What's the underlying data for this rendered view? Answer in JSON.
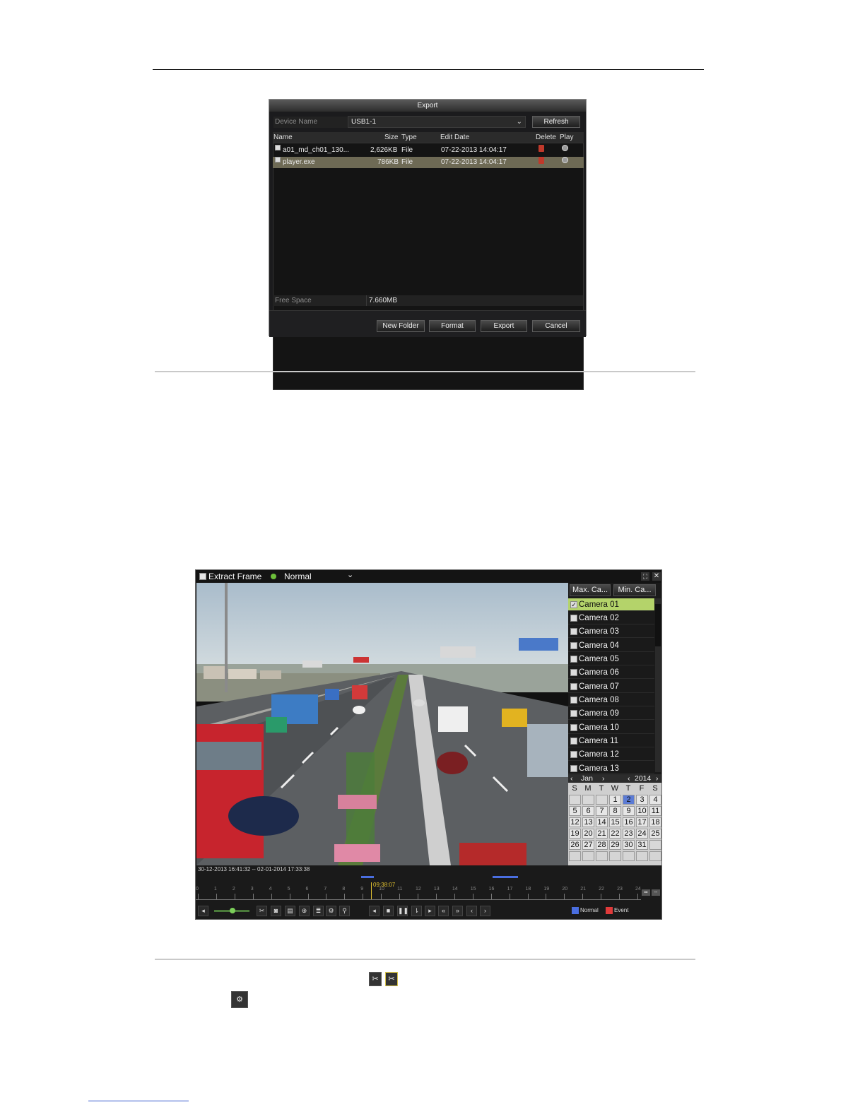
{
  "export_dialog": {
    "title": "Export",
    "device_name_label": "Device Name",
    "device_name_value": "USB1-1",
    "refresh_label": "Refresh",
    "columns": {
      "name": "Name",
      "size": "Size",
      "type": "Type",
      "edit_date": "Edit Date",
      "delete": "Delete",
      "play": "Play"
    },
    "files": [
      {
        "name": "a01_md_ch01_130...",
        "size": "2,626KB",
        "type": "File",
        "edit_date": "07-22-2013 14:04:17"
      },
      {
        "name": "player.exe",
        "size": "786KB",
        "type": "File",
        "edit_date": "07-22-2013 14:04:17"
      }
    ],
    "free_space_label": "Free Space",
    "free_space_value": "7.660MB",
    "buttons": {
      "new_folder": "New Folder",
      "format": "Format",
      "export": "Export",
      "cancel": "Cancel"
    }
  },
  "playback": {
    "extract_frame_label": "Extract Frame",
    "mode_value": "Normal",
    "tabs": {
      "max": "Max. Ca...",
      "min": "Min. Ca..."
    },
    "cameras": [
      "Camera 01",
      "Camera 02",
      "Camera 03",
      "Camera 04",
      "Camera 05",
      "Camera 06",
      "Camera 07",
      "Camera 08",
      "Camera 09",
      "Camera 10",
      "Camera 11",
      "Camera 12",
      "Camera 13"
    ],
    "calendar": {
      "month": "Jan",
      "year": "2014",
      "weekdays": [
        "S",
        "M",
        "T",
        "W",
        "T",
        "F",
        "S"
      ],
      "weeks": [
        [
          "",
          "",
          "",
          "1",
          "2",
          "3",
          "4"
        ],
        [
          "5",
          "6",
          "7",
          "8",
          "9",
          "10",
          "11"
        ],
        [
          "12",
          "13",
          "14",
          "15",
          "16",
          "17",
          "18"
        ],
        [
          "19",
          "20",
          "21",
          "22",
          "23",
          "24",
          "25"
        ],
        [
          "26",
          "27",
          "28",
          "29",
          "30",
          "31",
          ""
        ]
      ]
    },
    "time_range": "30-12-2013 16:41:32 -- 02-01-2014 17:33:38",
    "cursor_time": "09:38:07",
    "hours": [
      "0",
      "1",
      "2",
      "3",
      "4",
      "5",
      "6",
      "7",
      "8",
      "9",
      "10",
      "11",
      "12",
      "13",
      "14",
      "15",
      "16",
      "17",
      "18",
      "19",
      "20",
      "21",
      "22",
      "23",
      "24"
    ],
    "legend": {
      "normal": "Normal",
      "event": "Event",
      "normal_color": "#4a6ee0",
      "event_color": "#e03a3a"
    }
  }
}
